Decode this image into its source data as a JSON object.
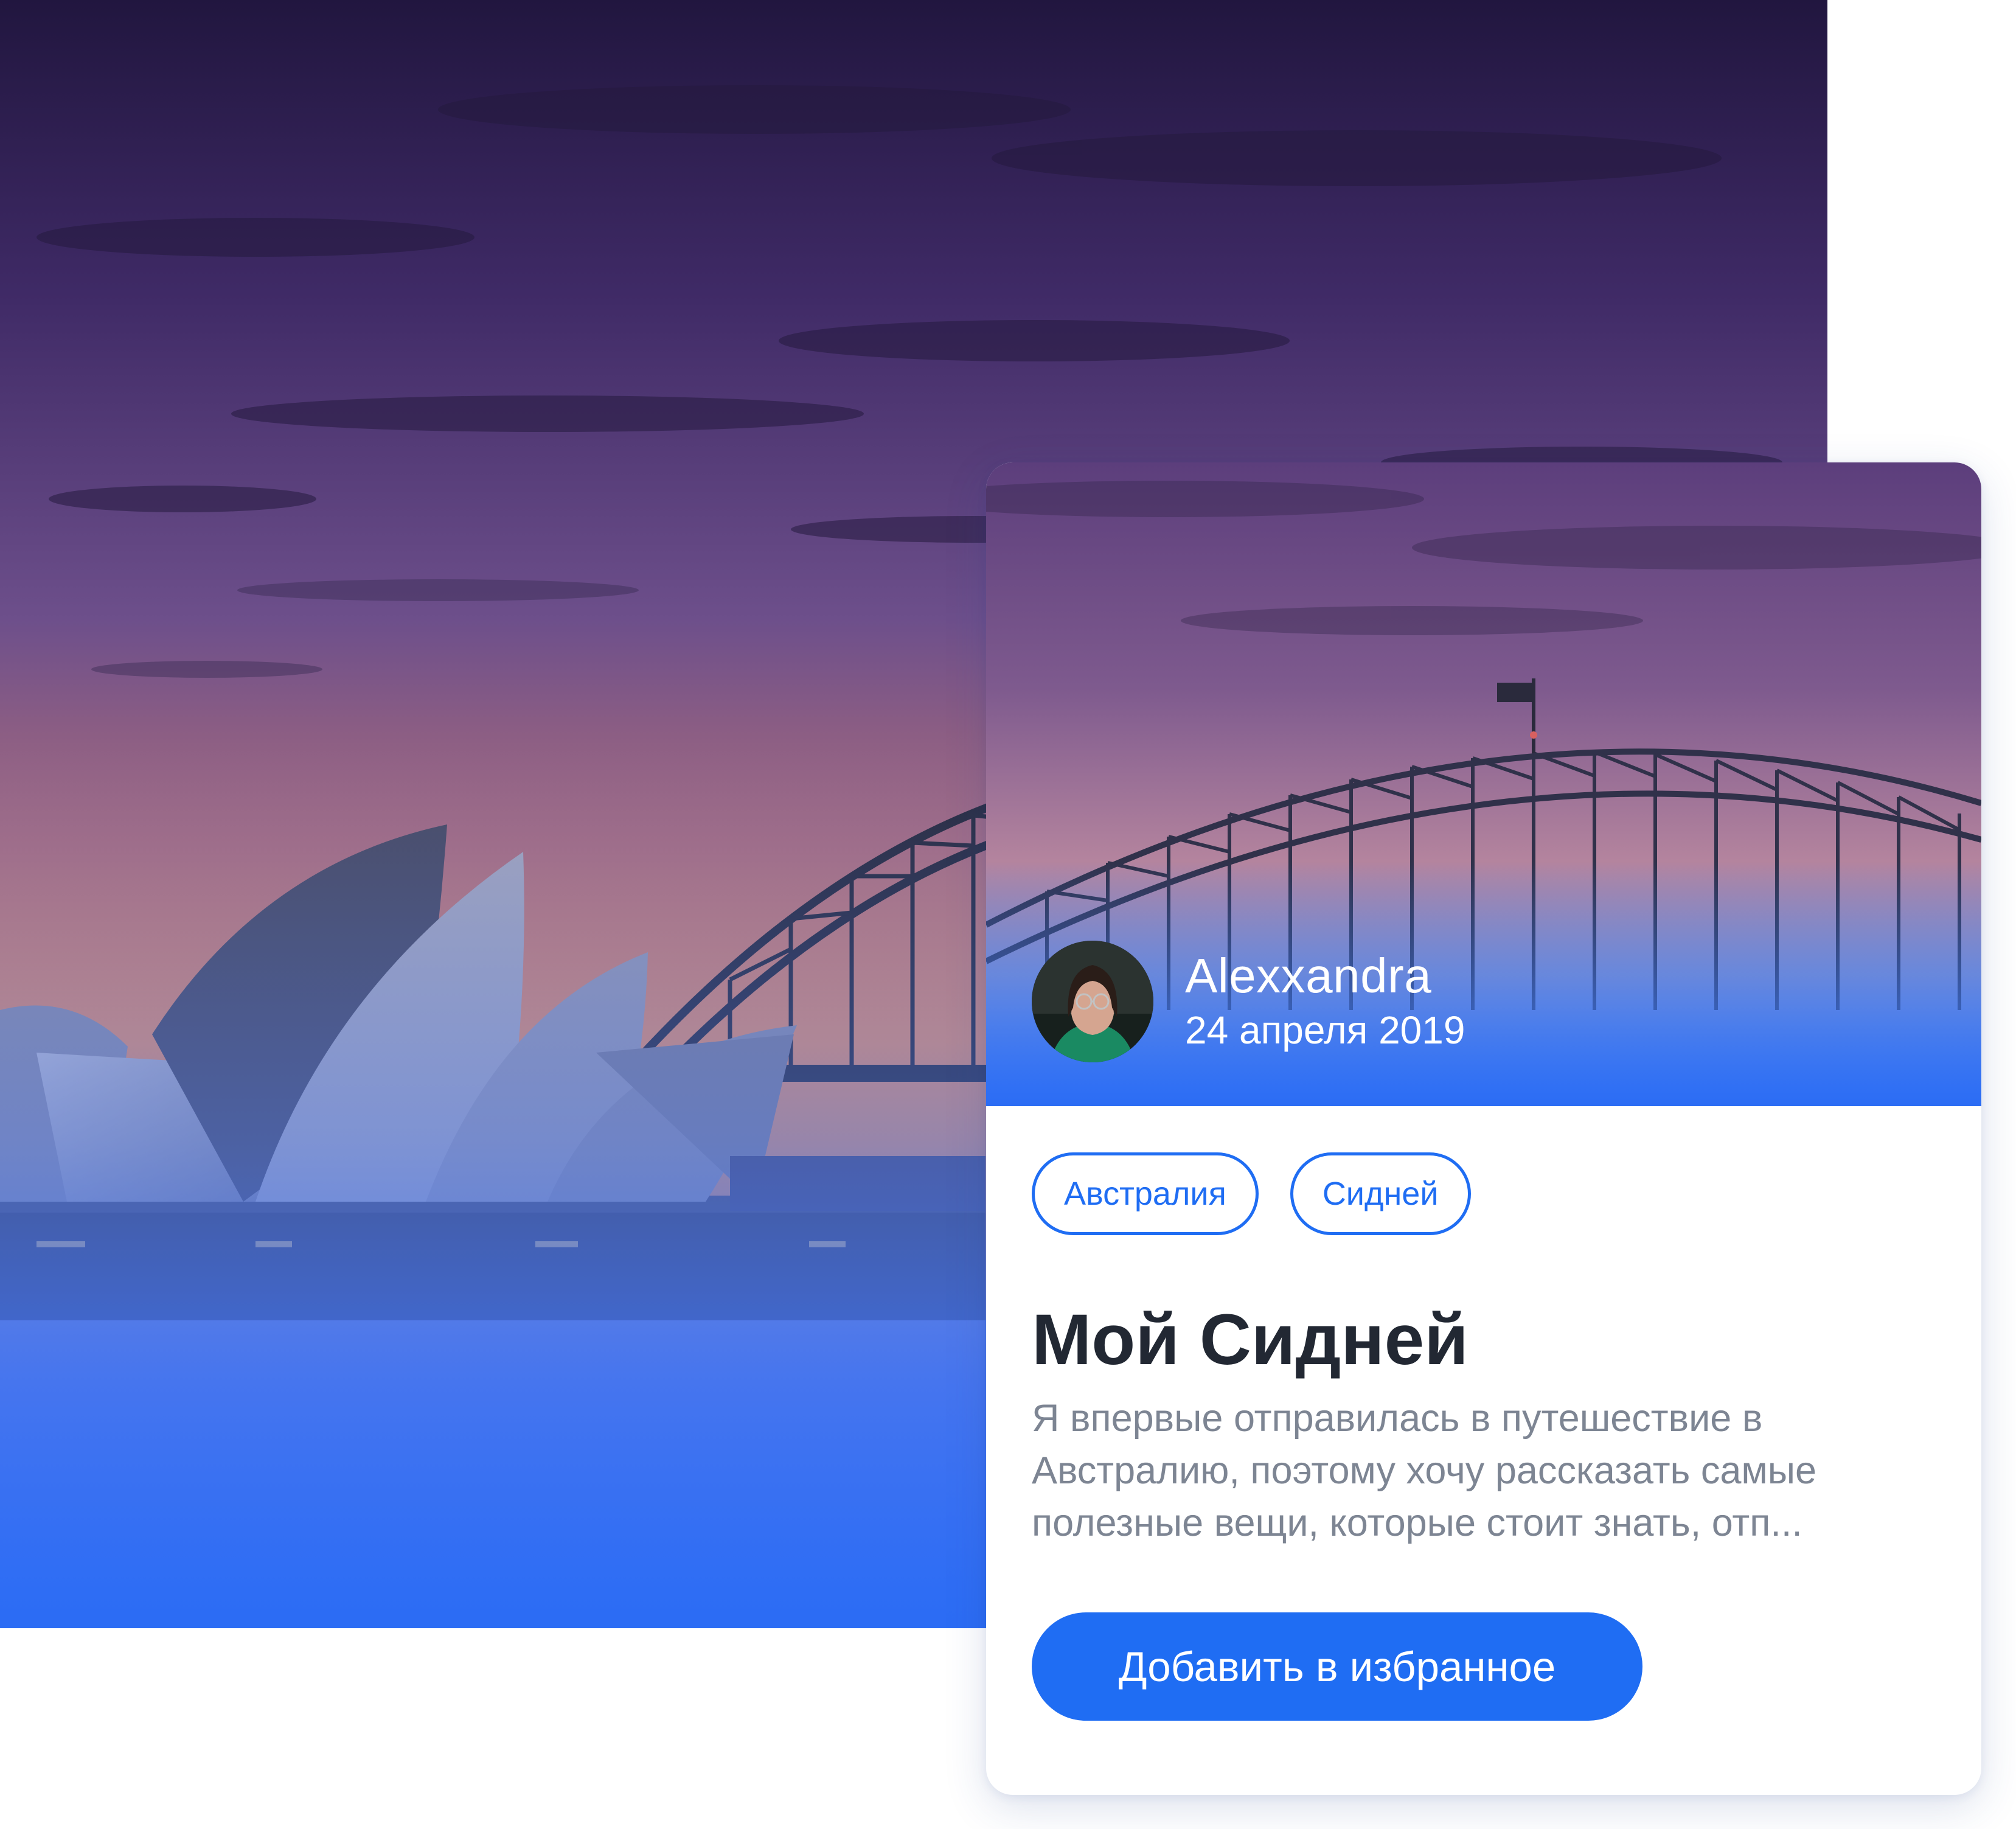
{
  "card": {
    "author": {
      "name": "Alexxandra",
      "date": "24 апреля 2019"
    },
    "tags": [
      "Австралия",
      "Сидней"
    ],
    "title": "Мой Сидней",
    "excerpt": [
      "Я впервые отправилась в путешествие в",
      "Австралию, поэтому хочу рассказать самые",
      "полезные вещи, которые стоит знать, отп..."
    ],
    "favorite_button_label": "Добавить в избранное"
  },
  "colors": {
    "accent": "#1f6df3",
    "title_text": "#222833",
    "body_text": "#7d8593",
    "sky_top": "#241844",
    "sky_middle": "#6e4f89",
    "sky_horizon": "#e18a68",
    "water": "#2b6cf4"
  },
  "icons": {
    "hero": "sydney-opera-house-harbour-bridge-photo",
    "avatar": "user-portrait-photo"
  }
}
